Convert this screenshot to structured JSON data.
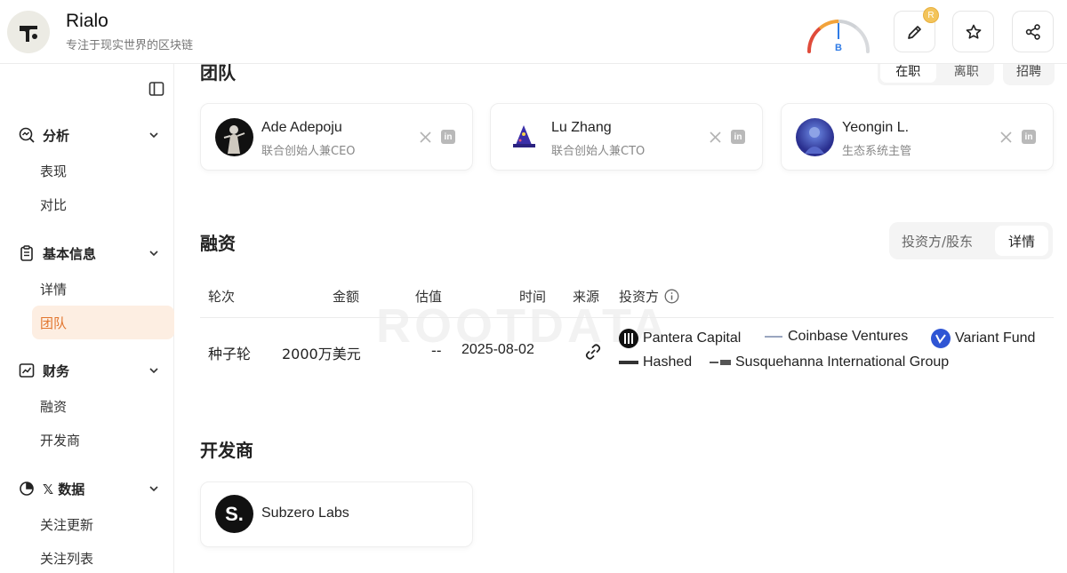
{
  "app": {
    "title": "Rialo",
    "subtitle": "专注于现实世界的区块链",
    "rating_letter": "B",
    "notification_badge": "R"
  },
  "colors": {
    "accent": "#e2762f",
    "active_bg": "#fdeee2",
    "rating_blue": "#2f7be6"
  },
  "sidebar": {
    "sections": [
      {
        "label": "分析",
        "icon": "analysis-icon",
        "items": [
          "表现",
          "对比"
        ]
      },
      {
        "label": "基本信息",
        "icon": "clipboard-icon",
        "items": [
          "详情",
          "团队"
        ]
      },
      {
        "label": "财务",
        "icon": "finance-chart-icon",
        "items": [
          "融资",
          "开发商"
        ]
      },
      {
        "label": "𝕏 数据",
        "icon": "pie-chart-icon",
        "items": [
          "关注更新",
          "关注列表"
        ]
      }
    ],
    "active_item": "团队"
  },
  "team": {
    "heading": "团队",
    "tabs": [
      "在职",
      "离职"
    ],
    "active_tab": "在职",
    "recruit_label": "招聘",
    "members": [
      {
        "name": "Ade Adepoju",
        "role": "联合创始人兼CEO"
      },
      {
        "name": "Lu Zhang",
        "role": "联合创始人兼CTO"
      },
      {
        "name": "Yeongin L.",
        "role": "生态系统主管"
      }
    ]
  },
  "funding": {
    "heading": "融资",
    "tabs": [
      "投资方/股东",
      "详情"
    ],
    "active_tab": "详情",
    "columns": [
      "轮次",
      "金额",
      "估值",
      "时间",
      "来源",
      "投资方"
    ],
    "watermark": "ROOTDATA",
    "rows": [
      {
        "round": "种子轮",
        "amount": "2000万美元",
        "valuation": "--",
        "date": "2025-08-02",
        "investors": [
          "Pantera Capital",
          "Coinbase Ventures",
          "Variant Fund",
          "Hashed",
          "Susquehanna International Group"
        ]
      }
    ]
  },
  "developers": {
    "heading": "开发商",
    "items": [
      {
        "name": "Subzero Labs",
        "logo_text": "S."
      }
    ]
  }
}
